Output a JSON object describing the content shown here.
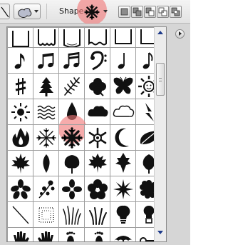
{
  "toolbar": {
    "shape_label": "Shape:",
    "selected_shape": "snowflake-asterisk",
    "tools": [
      "line-tool",
      "custom-shape-tool"
    ],
    "modes": [
      "new-layer",
      "add",
      "subtract",
      "intersect",
      "exclude"
    ]
  },
  "picker": {
    "selected_index": 22,
    "shapes": [
      "frame-plain",
      "frame-scalloped",
      "frame-ornate",
      "frame-wavy",
      "frame-plain-2",
      "frame-plain-3",
      "eighth-note",
      "beamed-eighth-notes",
      "beamed-sixteenth-notes",
      "bass-clef",
      "quarter-note",
      "eighth-note-2",
      "sharp-sign",
      "tree",
      "fern-leaf",
      "clover",
      "butterfly",
      "sun",
      "sun-rays",
      "waves",
      "raindrop",
      "cloud",
      "cloud-outline",
      "lightning",
      "fire",
      "snowflake",
      "snowflake-asterisk",
      "snowflake-crystal",
      "crescent-moon",
      "leaf",
      "maple-leaf",
      "oval-leaf",
      "ivy-leaf",
      "maple-leaf-2",
      "leaf-3",
      "leaf-4",
      "flower",
      "blossom-spray",
      "flower-4",
      "flower-5",
      "starburst",
      "scalloped-flower",
      "slash",
      "dotted-square",
      "grass",
      "grass-2",
      "lightbulb",
      "bulb",
      "hand-left",
      "hand-right",
      "footprint-left",
      "footprint-right",
      "umbrella",
      "key"
    ]
  },
  "colors": {
    "highlight": "#f07878",
    "scroll_arrow": "#1e3a8a",
    "icon": "#111111"
  }
}
